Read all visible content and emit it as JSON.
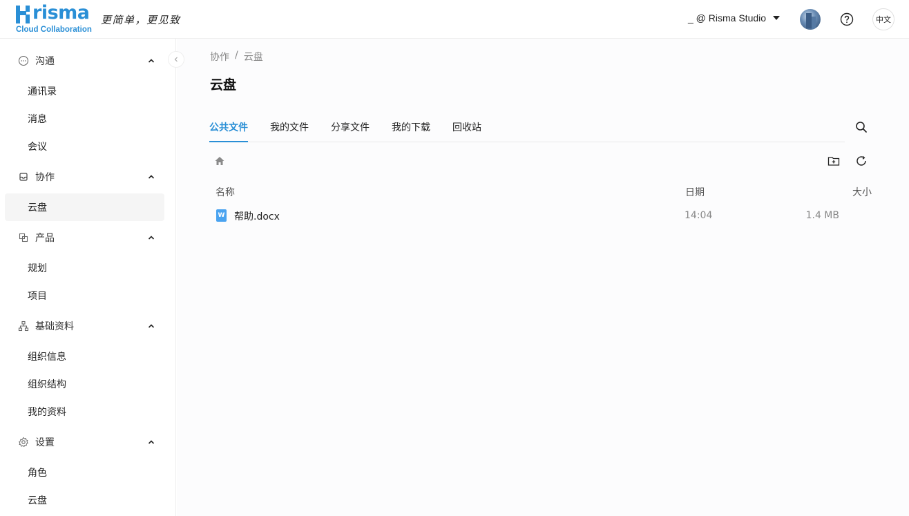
{
  "header": {
    "logo_text": "risma",
    "logo_sub": "Cloud Collaboration",
    "slogan": "更简单，更见致",
    "org": "_ @ Risma Studio",
    "lang": "中文"
  },
  "sidebar": {
    "groups": [
      {
        "label": "沟通",
        "items": [
          "通讯录",
          "消息",
          "会议"
        ]
      },
      {
        "label": "协作",
        "items": [
          "云盘"
        ]
      },
      {
        "label": "产品",
        "items": [
          "规划",
          "项目"
        ]
      },
      {
        "label": "基础资料",
        "items": [
          "组织信息",
          "组织结构",
          "我的资料"
        ]
      },
      {
        "label": "设置",
        "items": [
          "角色",
          "云盘"
        ]
      }
    ]
  },
  "main": {
    "breadcrumb": [
      "协作",
      "/",
      "云盘"
    ],
    "title": "云盘",
    "tabs": [
      "公共文件",
      "我的文件",
      "分享文件",
      "我的下载",
      "回收站"
    ],
    "active_tab": "公共文件",
    "columns": {
      "name": "名称",
      "date": "日期",
      "size": "大小"
    },
    "files": [
      {
        "name": "帮助.docx",
        "date": "14:04",
        "size": "1.4 MB",
        "icon": "W"
      }
    ]
  },
  "colors": {
    "accent": "#2a8fd6"
  }
}
